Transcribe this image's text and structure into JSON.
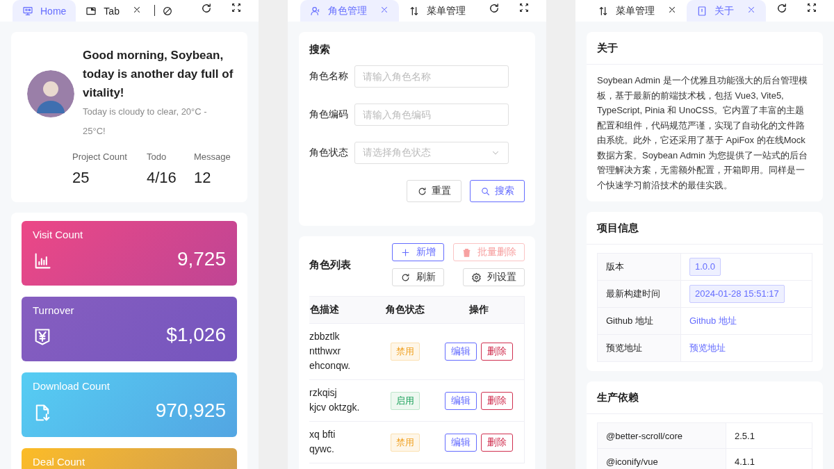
{
  "home": {
    "tabs": [
      {
        "label": "Home",
        "selected": true,
        "closable": false
      },
      {
        "label": "Tab",
        "selected": false,
        "closable": true
      }
    ],
    "greeting": "Good morning, Soybean, today is another day full of vitality!",
    "weather": "Today is cloudy to clear, 20°C - 25°C!",
    "stats": [
      {
        "label": "Project Count",
        "value": "25"
      },
      {
        "label": "Todo",
        "value": "4/16"
      },
      {
        "label": "Message",
        "value": "12"
      }
    ],
    "cards": [
      {
        "title": "Visit Count",
        "value": "9,725",
        "color": "#ec4786"
      },
      {
        "title": "Turnover",
        "value": "$1,026",
        "color": "#865ec0"
      },
      {
        "title": "Download Count",
        "value": "970,925",
        "color": "#56cdf3"
      },
      {
        "title": "Deal Count",
        "color": "#fcbc25"
      }
    ]
  },
  "roles": {
    "tabs": [
      {
        "label": "角色管理",
        "selected": true,
        "closable": true
      },
      {
        "label": "菜单管理",
        "selected": false,
        "closable": false
      }
    ],
    "search": {
      "title": "搜索",
      "fields": [
        {
          "label": "角色名称",
          "placeholder": "请输入角色名称",
          "kind": "input"
        },
        {
          "label": "角色编码",
          "placeholder": "请输入角色编码",
          "kind": "input"
        },
        {
          "label": "角色状态",
          "placeholder": "请选择角色状态",
          "kind": "select"
        }
      ],
      "buttons": [
        {
          "label": "重置",
          "kind": "reset"
        },
        {
          "label": "搜索",
          "kind": "search"
        }
      ]
    },
    "table": {
      "title": "角色列表",
      "actions": [
        {
          "label": "新增",
          "kind": "add",
          "disabled": false
        },
        {
          "label": "批量删除",
          "kind": "delete",
          "disabled": true
        },
        {
          "label": "刷新",
          "kind": "refresh",
          "disabled": false
        },
        {
          "label": "列设置",
          "kind": "settings",
          "disabled": false
        }
      ],
      "columns": [
        "色描述",
        "角色状态",
        "操作"
      ],
      "rows": [
        {
          "description": [
            "zbbztlk",
            "ntthwxr",
            "ehconqw."
          ],
          "status": "禁用",
          "enabled": false,
          "buttons": [
            "编辑",
            "删除"
          ]
        },
        {
          "description": [
            "rzkqisj",
            "kjcv oktzgk."
          ],
          "status": "启用",
          "enabled": true,
          "buttons": [
            "编辑",
            "删除"
          ]
        },
        {
          "description": [
            "xq bfti",
            "qywc."
          ],
          "status": "禁用",
          "enabled": false,
          "buttons": [
            "编辑",
            "删除"
          ]
        }
      ]
    }
  },
  "about": {
    "tabs": [
      {
        "label": "菜单管理",
        "selected": false,
        "closable": true
      },
      {
        "label": "关于",
        "selected": true,
        "closable": true
      }
    ],
    "intro": {
      "title": "关于",
      "text": "Soybean Admin 是一个优雅且功能强大的后台管理模板，基于最新的前端技术栈，包括 Vue3, Vite5, TypeScript, Pinia 和 UnoCSS。它内置了丰富的主题配置和组件，代码规范严谨，实现了自动化的文件路由系统。此外，它还采用了基于 ApiFox 的在线Mock数据方案。Soybean Admin 为您提供了一站式的后台管理解决方案，无需额外配置，开箱即用。同样是一个快速学习前沿技术的最佳实践。"
    },
    "project_info": {
      "title": "项目信息",
      "rows": [
        {
          "label": "版本",
          "value": "1.0.0",
          "kind": "tag"
        },
        {
          "label": "最新构建时间",
          "value": "2024-01-28 15:51:17",
          "kind": "tag"
        },
        {
          "label": "Github 地址",
          "value": "Github 地址",
          "kind": "link"
        },
        {
          "label": "预览地址",
          "value": "预览地址",
          "kind": "link"
        }
      ]
    },
    "dependencies": {
      "title": "生产依赖",
      "rows": [
        {
          "name": "@better-scroll/core",
          "version": "2.5.1"
        },
        {
          "name": "@iconify/vue",
          "version": "4.1.1"
        }
      ]
    }
  }
}
